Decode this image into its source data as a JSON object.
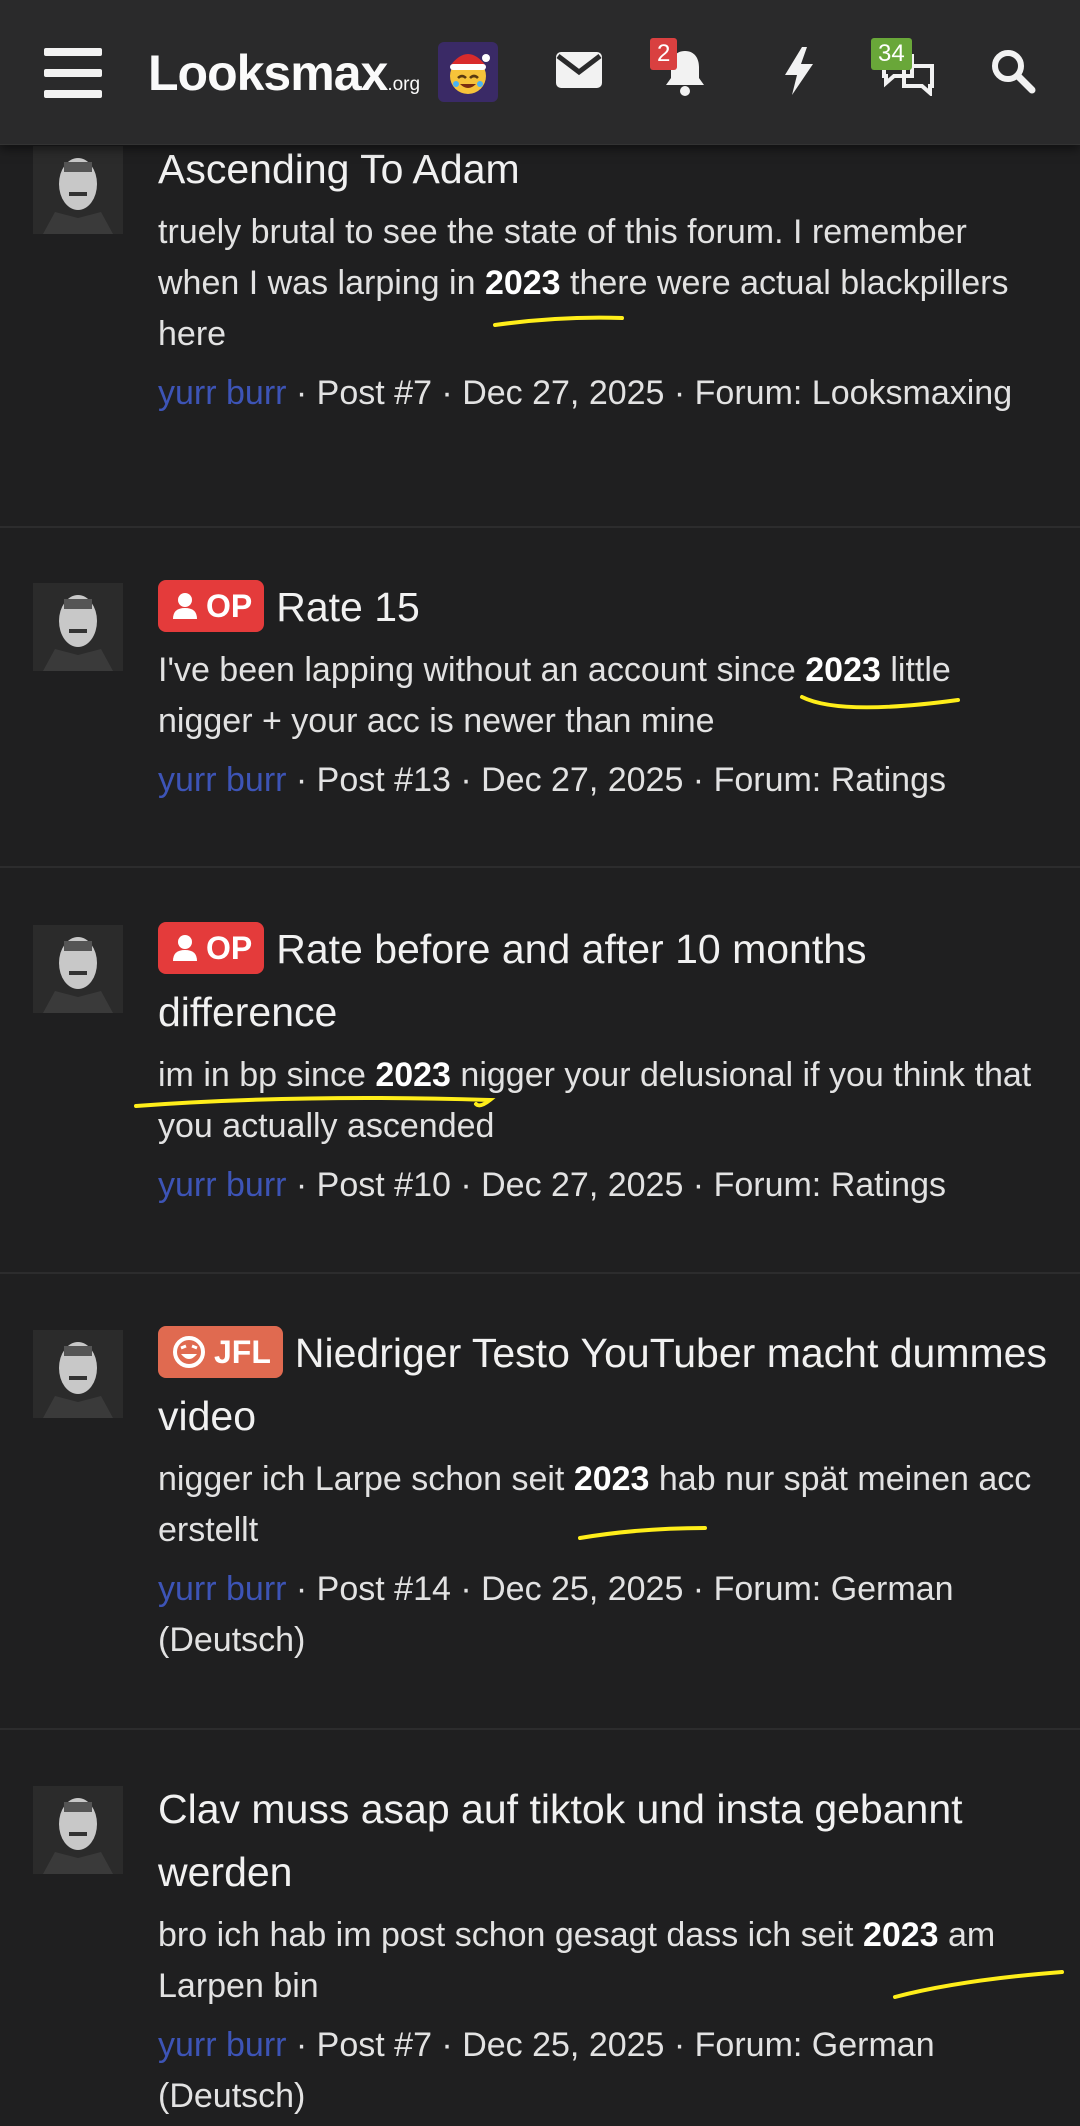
{
  "header": {
    "logo_main": "Looksmax",
    "logo_suffix": ".org",
    "notification_count": "2",
    "conversation_count": "34",
    "colors": {
      "bar": "#2a2a2b",
      "notif_badge": "#d94040",
      "convo_badge": "#69a739"
    }
  },
  "results": [
    {
      "title": "Ascending To Adam",
      "prefix": "",
      "snippet_before": "truely brutal to see the state of this forum. I remember when I was larping in ",
      "snippet_bold": "2023",
      "snippet_after": " there were actual blackpillers here",
      "author": "yurr burr",
      "meta": " · Post #7 · Dec 27, 2025 · Forum: Looksmaxing"
    },
    {
      "title": "Rate 15",
      "prefix": "OP",
      "snippet_before": "I've been lapping without an account since ",
      "snippet_bold": "2023",
      "snippet_after": " little nigger + your acc is newer than mine",
      "author": "yurr burr",
      "meta": " · Post #13 · Dec 27, 2025 · Forum: Ratings"
    },
    {
      "title": "Rate before and after 10 months difference",
      "prefix": "OP",
      "snippet_before": "im in bp since ",
      "snippet_bold": "2023",
      "snippet_after": " nigger your delusional if you think that you actually ascended",
      "author": "yurr burr",
      "meta": " · Post #10 · Dec 27, 2025 · Forum: Ratings"
    },
    {
      "title": "Niedriger Testo YouTuber macht dummes video",
      "prefix": "JFL",
      "snippet_before": "nigger ich Larpe schon seit ",
      "snippet_bold": "2023",
      "snippet_after": " hab nur spät meinen acc erstellt",
      "author": "yurr burr",
      "meta": " · Post #14 · Dec 25, 2025 · Forum: German (Deutsch)"
    },
    {
      "title": "Clav muss asap auf tiktok und insta gebannt werden",
      "prefix": "",
      "snippet_before": "bro ich hab im post schon gesagt dass ich seit ",
      "snippet_bold": "2023",
      "snippet_after": " am Larpen bin",
      "author": "yurr burr",
      "meta": " · Post #7 · Dec 25, 2025 · Forum: German (Deutsch)"
    }
  ],
  "icons": [
    "menu-icon",
    "envelope-icon",
    "bell-icon",
    "bolt-icon",
    "chat-icon",
    "search-icon",
    "user-icon",
    "laugh-icon"
  ],
  "annotation_color": "#ffee1a"
}
